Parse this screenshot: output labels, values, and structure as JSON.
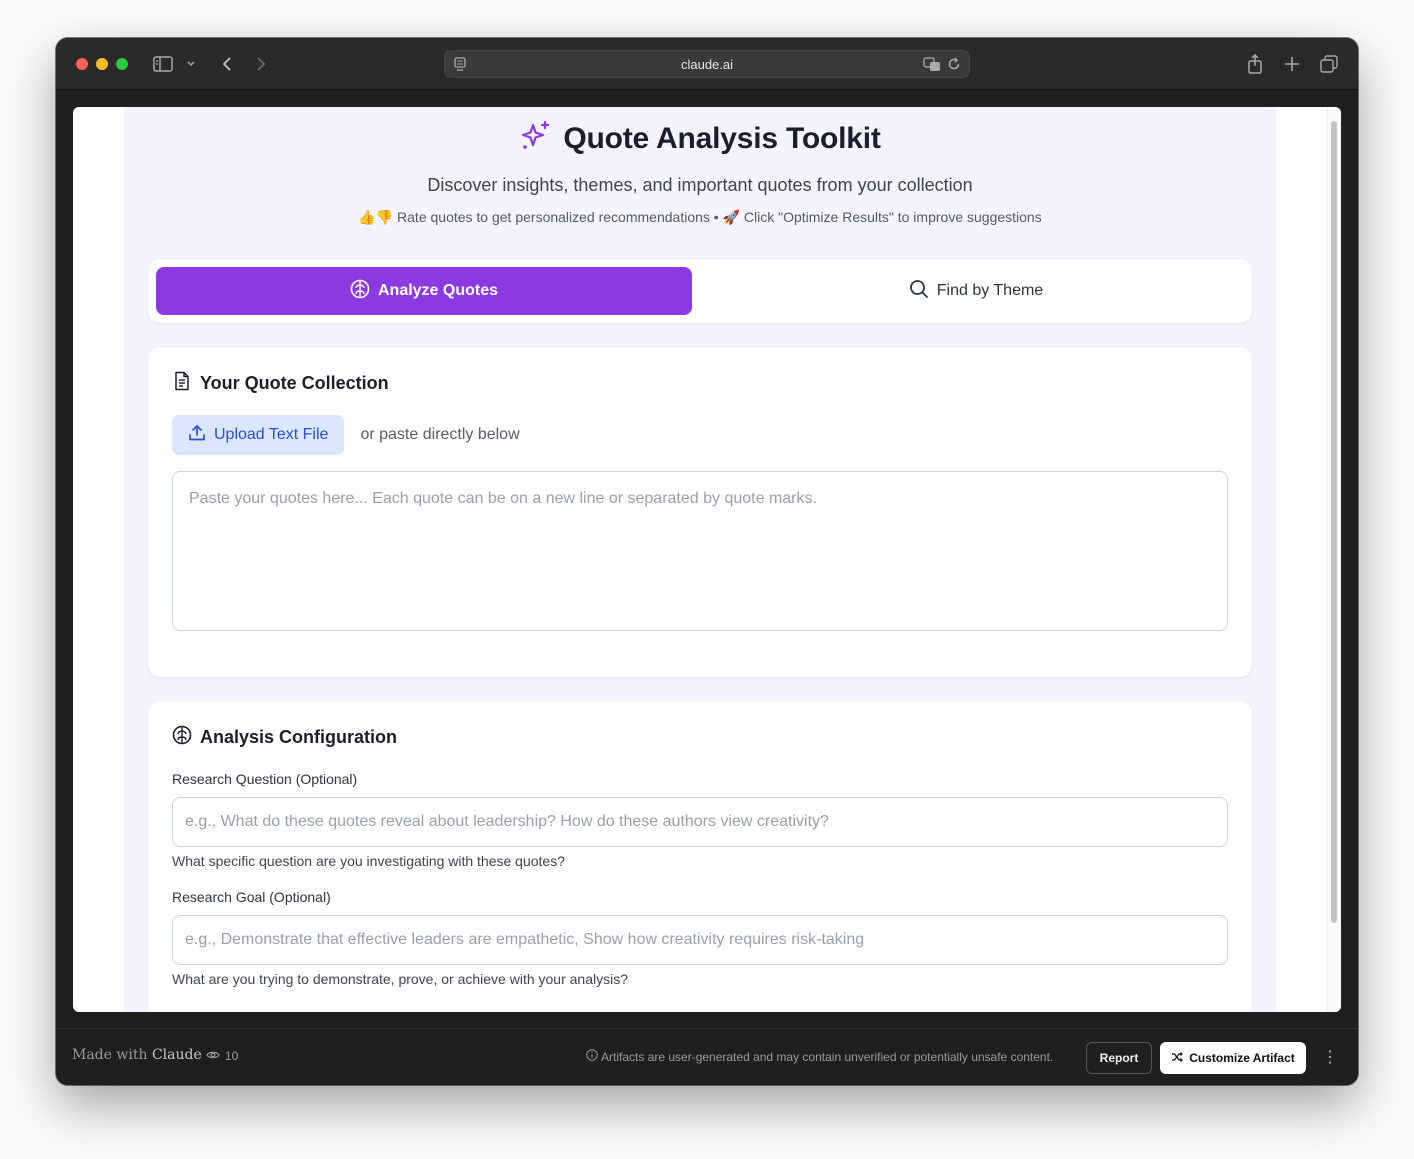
{
  "browser": {
    "url": "claude.ai"
  },
  "app": {
    "title": "Quote Analysis Toolkit",
    "subtitle": "Discover insights, themes, and important quotes from your collection",
    "tip": "👍👎 Rate quotes to get personalized recommendations • 🚀 Click \"Optimize Results\" to improve suggestions",
    "accent_color": "#8b3ae1"
  },
  "tabs": [
    {
      "label": "Analyze Quotes",
      "icon": "brain-icon",
      "active": true
    },
    {
      "label": "Find by Theme",
      "icon": "search-icon",
      "active": false
    }
  ],
  "collection": {
    "title": "Your Quote Collection",
    "upload_label": "Upload Text File",
    "upload_note": "or paste directly below",
    "textarea_placeholder": "Paste your quotes here... Each quote can be on a new line or separated by quote marks."
  },
  "config": {
    "title": "Analysis Configuration",
    "question_label": "Research Question (Optional)",
    "question_placeholder": "e.g., What do these quotes reveal about leadership? How do these authors view creativity?",
    "question_help": "What specific question are you investigating with these quotes?",
    "goal_label": "Research Goal (Optional)",
    "goal_placeholder": "e.g., Demonstrate that effective leaders are empathetic, Show how creativity requires risk-taking",
    "goal_help": "What are you trying to demonstrate, prove, or achieve with your analysis?"
  },
  "footer": {
    "made_with_prefix": "Made with",
    "made_with_brand": "Claude",
    "views": "10",
    "disclaimer": "Artifacts are user-generated and may contain unverified or potentially unsafe content.",
    "report_label": "Report",
    "customize_label": "Customize Artifact"
  }
}
